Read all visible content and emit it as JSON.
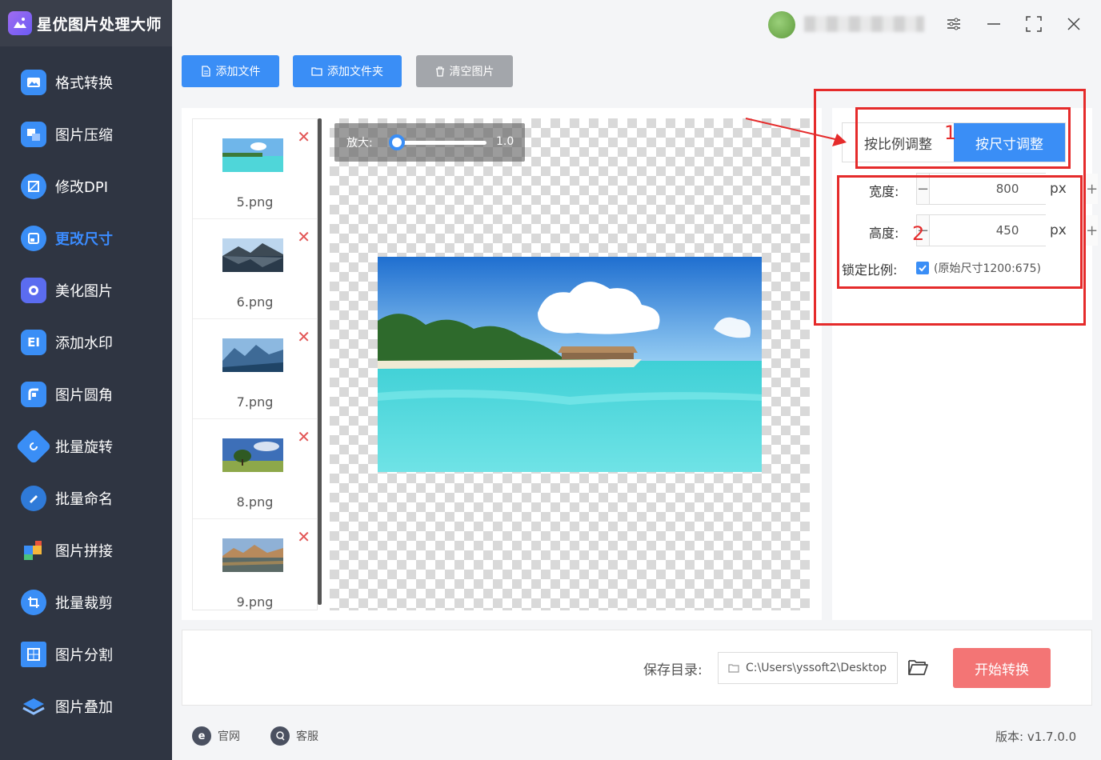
{
  "app": {
    "title": "星优图片处理大师"
  },
  "sidebar": {
    "items": [
      {
        "label": "格式转换",
        "icon": "image-convert-icon",
        "color": "#3a8ef6"
      },
      {
        "label": "图片压缩",
        "icon": "compress-icon",
        "color": "#3a8ef6"
      },
      {
        "label": "修改DPI",
        "icon": "dpi-icon",
        "color": "#3a8ef6"
      },
      {
        "label": "更改尺寸",
        "icon": "resize-icon",
        "color": "#3a8ef6",
        "active": true
      },
      {
        "label": "美化图片",
        "icon": "beautify-icon",
        "color": "#5b6cf0"
      },
      {
        "label": "添加水印",
        "icon": "watermark-icon",
        "color": "#3a8ef6"
      },
      {
        "label": "图片圆角",
        "icon": "rounded-corner-icon",
        "color": "#3a8ef6"
      },
      {
        "label": "批量旋转",
        "icon": "rotate-icon",
        "color": "#3a8ef6"
      },
      {
        "label": "批量命名",
        "icon": "rename-icon",
        "color": "#2f7ad8"
      },
      {
        "label": "图片拼接",
        "icon": "puzzle-icon",
        "color": "#e8533b"
      },
      {
        "label": "批量裁剪",
        "icon": "crop-icon",
        "color": "#3a8ef6"
      },
      {
        "label": "图片分割",
        "icon": "split-icon",
        "color": "#3a8ef6"
      },
      {
        "label": "图片叠加",
        "icon": "layers-icon",
        "color": "#3a8ef6"
      }
    ]
  },
  "toolbar": {
    "add_file": "添加文件",
    "add_folder": "添加文件夹",
    "clear": "清空图片"
  },
  "files": [
    {
      "name": "5.png",
      "thumb": "beach"
    },
    {
      "name": "6.png",
      "thumb": "lake"
    },
    {
      "name": "7.png",
      "thumb": "mountains"
    },
    {
      "name": "8.png",
      "thumb": "tree"
    },
    {
      "name": "9.png",
      "thumb": "sunset"
    }
  ],
  "preview": {
    "zoom_label": "放大:",
    "zoom_value": "1.0",
    "zoom_fraction": 0.0
  },
  "settings": {
    "mode_ratio": "按比例调整",
    "mode_size": "按尺寸调整",
    "width_label": "宽度:",
    "width_value": "800",
    "height_label": "高度:",
    "height_value": "450",
    "unit": "px",
    "lock_label": "锁定比例:",
    "lock_checked": true,
    "original_size": "(原始尺寸1200:675)"
  },
  "annotations": {
    "num1": "1",
    "num2": "2"
  },
  "bottom": {
    "save_label": "保存目录:",
    "save_path": "C:\\Users\\yssoft2\\Desktop",
    "start_button": "开始转换"
  },
  "footer": {
    "website": "官网",
    "service": "客服",
    "version": "版本: v1.7.0.0"
  },
  "colors": {
    "accent": "#3a8ef6",
    "sidebar_bg": "#2f3542",
    "start_btn": "#f37575",
    "annotation": "#e52b2b"
  }
}
